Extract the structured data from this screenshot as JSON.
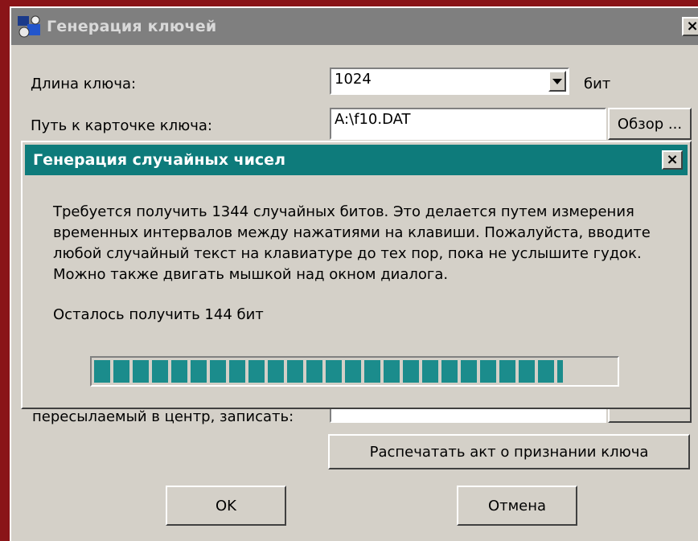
{
  "main_window": {
    "title": "Генерация ключей",
    "close_label": "×",
    "key_length_label": "Длина ключа:",
    "key_length_value": "1024",
    "key_length_unit": "бит",
    "key_path_label": "Путь к карточке ключа:",
    "key_path_value": "A:\\f10.DAT",
    "browse_label": "Обзор ...",
    "send_label": "пересылаемый в центр, записать:",
    "print_act_label": "Распечатать акт о признании ключа",
    "ok_label": "OK",
    "cancel_label": "Отмена"
  },
  "random_dialog": {
    "title": "Генерация случайных чисел",
    "close_label": "×",
    "message": "Требуется получить 1344 случайных битов. Это делается путем измерения временных интервалов между нажатиями на клавиши. Пожалуйста, вводите любой случайный текст на клавиатуре до тех пор, пока не услышите гудок. Можно также двигать мышкой над окном диалога.",
    "remaining_text": "Осталось получить 144 бит",
    "progress_fraction": 0.9
  },
  "colors": {
    "dialog_title_bg": "#0e7b7b",
    "progress_fill": "#1b8c8c",
    "window_bg": "#d4d0c8",
    "desktop_bg": "#8a1418"
  }
}
